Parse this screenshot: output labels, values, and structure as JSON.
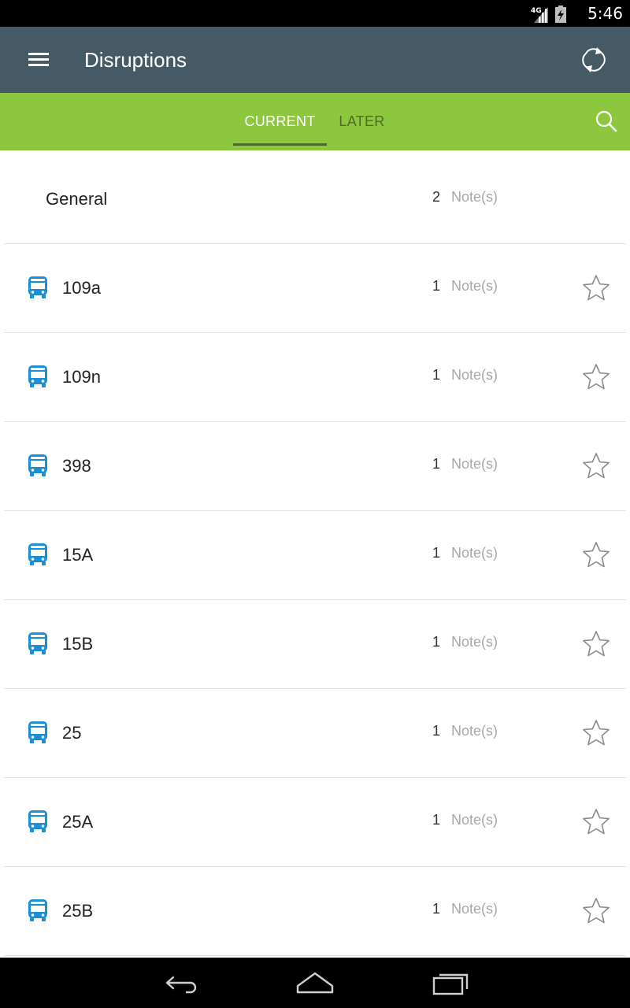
{
  "status_bar": {
    "network": "4G",
    "time": "5:46"
  },
  "app_bar": {
    "title": "Disruptions",
    "menu_icon": "menu-icon",
    "refresh_icon": "refresh-icon"
  },
  "tabs": [
    {
      "label": "CURRENT",
      "selected": true
    },
    {
      "label": "LATER",
      "selected": false
    }
  ],
  "search_icon": "search-icon",
  "general": {
    "title": "General",
    "note_count": "2",
    "note_label": "Note(s)"
  },
  "routes": [
    {
      "name": "109a",
      "note_count": "1",
      "note_label": "Note(s)",
      "icon": "bus-icon",
      "favorite": false
    },
    {
      "name": "109n",
      "note_count": "1",
      "note_label": "Note(s)",
      "icon": "bus-icon",
      "favorite": false
    },
    {
      "name": "398",
      "note_count": "1",
      "note_label": "Note(s)",
      "icon": "bus-icon",
      "favorite": false
    },
    {
      "name": "15A",
      "note_count": "1",
      "note_label": "Note(s)",
      "icon": "bus-icon",
      "favorite": false
    },
    {
      "name": "15B",
      "note_count": "1",
      "note_label": "Note(s)",
      "icon": "bus-icon",
      "favorite": false
    },
    {
      "name": "25",
      "note_count": "1",
      "note_label": "Note(s)",
      "icon": "bus-icon",
      "favorite": false
    },
    {
      "name": "25A",
      "note_count": "1",
      "note_label": "Note(s)",
      "icon": "bus-icon",
      "favorite": false
    },
    {
      "name": "25B",
      "note_count": "1",
      "note_label": "Note(s)",
      "icon": "bus-icon",
      "favorite": false
    }
  ],
  "colors": {
    "app_bar": "#455a64",
    "tab_bar": "#8dc63f",
    "bus_icon": "#1a8fd6"
  }
}
